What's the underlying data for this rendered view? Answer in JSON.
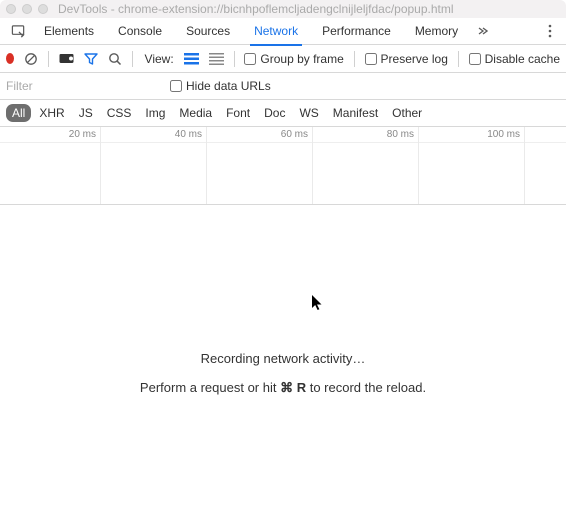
{
  "window": {
    "title": "DevTools - chrome-extension://bicnhpoflemcljadengclnijleljfdac/popup.html"
  },
  "tabs": [
    {
      "label": "Elements",
      "active": false
    },
    {
      "label": "Console",
      "active": false
    },
    {
      "label": "Sources",
      "active": false
    },
    {
      "label": "Network",
      "active": true
    },
    {
      "label": "Performance",
      "active": false
    },
    {
      "label": "Memory",
      "active": false
    }
  ],
  "toolbar": {
    "view_label": "View:",
    "group_label": "Group by frame",
    "preserve_label": "Preserve log",
    "disable_cache_label": "Disable cache"
  },
  "filter": {
    "placeholder": "Filter",
    "hide_data_urls_label": "Hide data URLs"
  },
  "filter_tabs": [
    "All",
    "XHR",
    "JS",
    "CSS",
    "Img",
    "Media",
    "Font",
    "Doc",
    "WS",
    "Manifest",
    "Other"
  ],
  "timeline": {
    "ticks": [
      "20 ms",
      "40 ms",
      "60 ms",
      "80 ms",
      "100 ms"
    ]
  },
  "content": {
    "line1": "Recording network activity…",
    "line2_pre": "Perform a request or hit ",
    "line2_kbd": "⌘ R",
    "line2_post": " to record the reload."
  }
}
